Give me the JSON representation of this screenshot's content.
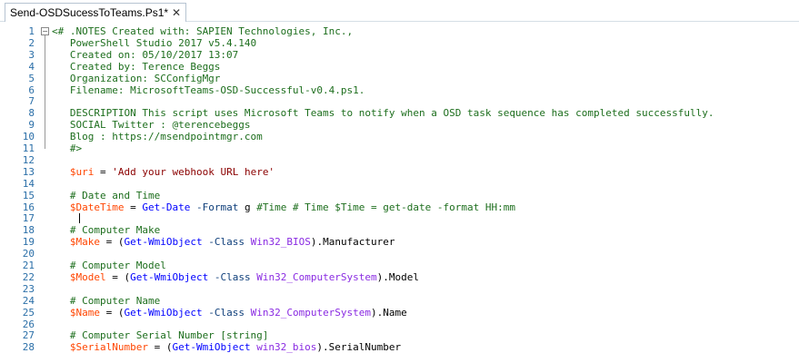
{
  "tab": {
    "title": "Send-OSDSucessToTeams.Ps1*",
    "close_icon": "close-icon"
  },
  "code_lines": [
    [
      {
        "t": "<# .NOTES Created with: SAPIEN Technologies, Inc.,",
        "c": "cmt"
      }
    ],
    [
      {
        "t": "   PowerShell Studio 2017 v5.4.140",
        "c": "cmt"
      }
    ],
    [
      {
        "t": "   Created on: 05/10/2017 13:07",
        "c": "cmt"
      }
    ],
    [
      {
        "t": "   Created by: Terence Beggs",
        "c": "cmt"
      }
    ],
    [
      {
        "t": "   Organization: SCConfigMgr",
        "c": "cmt"
      }
    ],
    [
      {
        "t": "   Filename: MicrosoftTeams-OSD-Successful-v0.4.ps1.",
        "c": "cmt"
      }
    ],
    [
      {
        "t": "",
        "c": ""
      }
    ],
    [
      {
        "t": "   DESCRIPTION This script uses Microsoft Teams to notify when a OSD task sequence has completed successfully.",
        "c": "cmt"
      }
    ],
    [
      {
        "t": "   SOCIAL Twitter : @terencebeggs",
        "c": "cmt"
      }
    ],
    [
      {
        "t": "   Blog : https://msendpointmgr.com",
        "c": "cmt"
      }
    ],
    [
      {
        "t": "   #>",
        "c": "cmt"
      }
    ],
    [
      {
        "t": "",
        "c": ""
      }
    ],
    [
      {
        "t": "   ",
        "c": ""
      },
      {
        "t": "$uri",
        "c": "var"
      },
      {
        "t": " = ",
        "c": ""
      },
      {
        "t": "'Add your webhook URL here'",
        "c": "str"
      }
    ],
    [
      {
        "t": "",
        "c": ""
      }
    ],
    [
      {
        "t": "   # Date and Time",
        "c": "cmt"
      }
    ],
    [
      {
        "t": "   ",
        "c": ""
      },
      {
        "t": "$DateTime",
        "c": "var"
      },
      {
        "t": " = ",
        "c": ""
      },
      {
        "t": "Get-Date",
        "c": "cmd"
      },
      {
        "t": " ",
        "c": ""
      },
      {
        "t": "-Format",
        "c": "par"
      },
      {
        "t": " g ",
        "c": ""
      },
      {
        "t": "#Time # Time $Time = get-date -format HH:mm",
        "c": "cmt"
      }
    ],
    [
      {
        "t": "",
        "c": ""
      }
    ],
    [
      {
        "t": "   # Computer Make",
        "c": "cmt"
      }
    ],
    [
      {
        "t": "   ",
        "c": ""
      },
      {
        "t": "$Make",
        "c": "var"
      },
      {
        "t": " = (",
        "c": ""
      },
      {
        "t": "Get-WmiObject",
        "c": "cmd"
      },
      {
        "t": " ",
        "c": ""
      },
      {
        "t": "-Class",
        "c": "par"
      },
      {
        "t": " ",
        "c": ""
      },
      {
        "t": "Win32_BIOS",
        "c": "typ"
      },
      {
        "t": ").Manufacturer",
        "c": ""
      }
    ],
    [
      {
        "t": "",
        "c": ""
      }
    ],
    [
      {
        "t": "   # Computer Model",
        "c": "cmt"
      }
    ],
    [
      {
        "t": "   ",
        "c": ""
      },
      {
        "t": "$Model",
        "c": "var"
      },
      {
        "t": " = (",
        "c": ""
      },
      {
        "t": "Get-WmiObject",
        "c": "cmd"
      },
      {
        "t": " ",
        "c": ""
      },
      {
        "t": "-Class",
        "c": "par"
      },
      {
        "t": " ",
        "c": ""
      },
      {
        "t": "Win32_ComputerSystem",
        "c": "typ"
      },
      {
        "t": ").Model",
        "c": ""
      }
    ],
    [
      {
        "t": "",
        "c": ""
      }
    ],
    [
      {
        "t": "   # Computer Name",
        "c": "cmt"
      }
    ],
    [
      {
        "t": "   ",
        "c": ""
      },
      {
        "t": "$Name",
        "c": "var"
      },
      {
        "t": " = (",
        "c": ""
      },
      {
        "t": "Get-WmiObject",
        "c": "cmd"
      },
      {
        "t": " ",
        "c": ""
      },
      {
        "t": "-Class",
        "c": "par"
      },
      {
        "t": " ",
        "c": ""
      },
      {
        "t": "Win32_ComputerSystem",
        "c": "typ"
      },
      {
        "t": ").Name",
        "c": ""
      }
    ],
    [
      {
        "t": "",
        "c": ""
      }
    ],
    [
      {
        "t": "   # Computer Serial Number [string]",
        "c": "cmt"
      }
    ],
    [
      {
        "t": "   ",
        "c": ""
      },
      {
        "t": "$SerialNumber",
        "c": "var"
      },
      {
        "t": " = (",
        "c": ""
      },
      {
        "t": "Get-WmiObject",
        "c": "cmd"
      },
      {
        "t": " ",
        "c": ""
      },
      {
        "t": "win32_bios",
        "c": "typ"
      },
      {
        "t": ").SerialNumber",
        "c": ""
      }
    ]
  ],
  "colors": {
    "comment": "#1d6e1d",
    "variable": "#ff4500",
    "string": "#8b0000",
    "cmdlet": "#0000ff",
    "parameter": "#0e3e7a",
    "type": "#8a2be2",
    "line_number": "#2b6fa8"
  }
}
